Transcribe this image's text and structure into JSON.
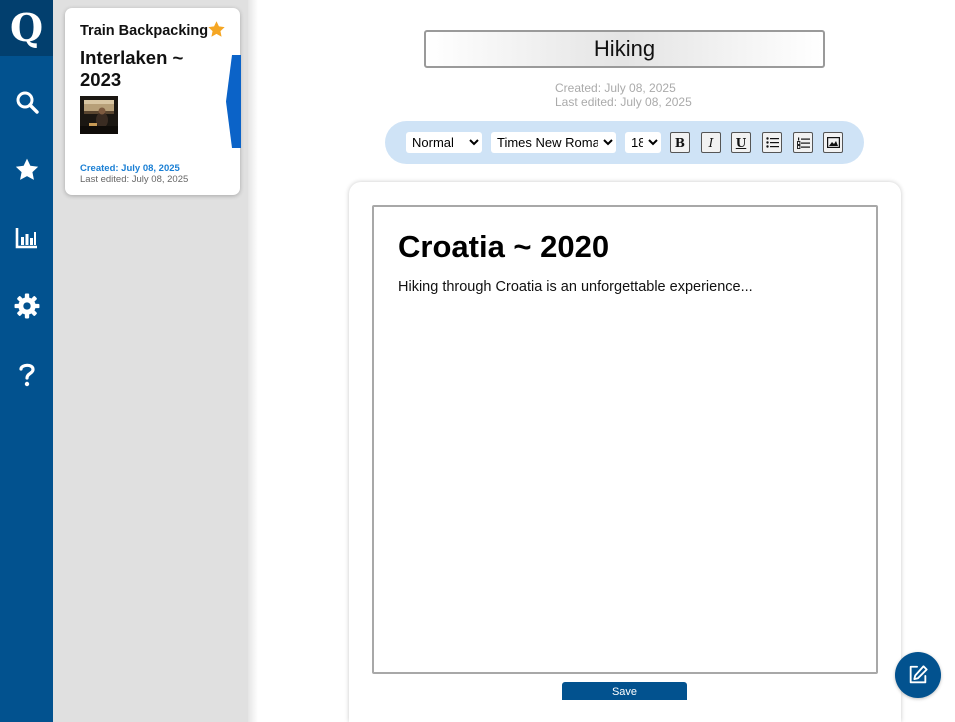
{
  "app": {
    "logo_letter": "Q"
  },
  "nav": [
    {
      "name": "search",
      "icon": "search-icon"
    },
    {
      "name": "favorites",
      "icon": "star-icon"
    },
    {
      "name": "stats",
      "icon": "bar-chart-icon"
    },
    {
      "name": "settings",
      "icon": "gear-icon"
    },
    {
      "name": "help",
      "icon": "question-icon"
    }
  ],
  "note_list": [
    {
      "category": "Train Backpacking",
      "title": "Interlaken ~ 2023",
      "favorite": true,
      "created": "Created: July 08, 2025",
      "last_edited": "Last edited: July 08, 2025",
      "thumbnail": "train-window-photo"
    }
  ],
  "editor": {
    "category_value": "Hiking",
    "created": "Created: July 08, 2025",
    "last_edited": "Last edited: July 08, 2025",
    "heading": "Croatia ~ 2020",
    "body": "Hiking through Croatia is an unforgettable experience...",
    "save_label": "Save"
  },
  "toolbar": {
    "style_selected": "Normal",
    "font_selected": "Times New Roman",
    "size_selected": "18",
    "bold": "B",
    "italic": "I",
    "underline": "U"
  },
  "colors": {
    "brand": "#02528f",
    "brand_dark": "#023f6e",
    "star": "#f5a623",
    "toolbar_bg": "#cfe3f6",
    "created_link": "#1a7fd4"
  }
}
